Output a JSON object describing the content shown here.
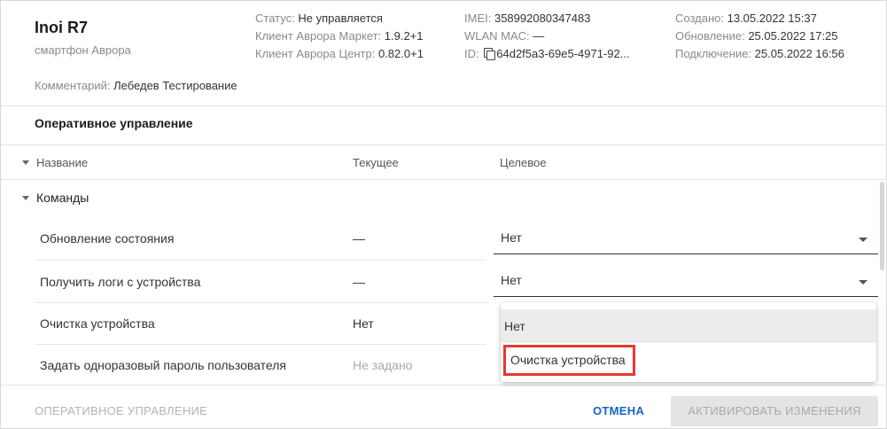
{
  "device": {
    "name": "Inoi R7",
    "type": "смартфон Аврора",
    "comment_label": "Комментарий:",
    "comment_value": "Лебедев Тестирование"
  },
  "meta": {
    "status_label": "Статус:",
    "status_value": "Не управляется",
    "market_label": "Клиент Аврора Маркет:",
    "market_value": "1.9.2+1",
    "center_label": "Клиент Аврора Центр:",
    "center_value": "0.82.0+1",
    "imei_label": "IMEI:",
    "imei_value": "358992080347483",
    "wlan_label": "WLAN MAC:",
    "wlan_value": "—",
    "id_label": "ID:",
    "id_value": "64d2f5a3-69e5-4971-92...",
    "created_label": "Создано:",
    "created_value": "13.05.2022 15:37",
    "updated_label": "Обновление:",
    "updated_value": "25.05.2022 17:25",
    "connected_label": "Подключение:",
    "connected_value": "25.05.2022 16:56"
  },
  "section_title": "Оперативное управление",
  "table": {
    "col_name": "Название",
    "col_current": "Текущее",
    "col_target": "Целевое",
    "group": "Команды",
    "rows": [
      {
        "label": "Обновление состояния",
        "current": "—",
        "target": "Нет"
      },
      {
        "label": "Получить логи с устройства",
        "current": "—",
        "target": "Нет"
      },
      {
        "label": "Очистка устройства",
        "current": "Нет"
      },
      {
        "label": "Задать одноразовый пароль пользователя",
        "current": "Не задано"
      }
    ]
  },
  "dropdown": {
    "options": [
      "Нет",
      "Очистка устройства"
    ]
  },
  "footer": {
    "left": "ОПЕРАТИВНОЕ УПРАВЛЕНИЕ",
    "cancel": "ОТМЕНА",
    "activate": "АКТИВИРОВАТЬ ИЗМЕНЕНИЯ"
  },
  "colors": {
    "accent": "#1565c0",
    "highlight_box": "#e53935"
  }
}
